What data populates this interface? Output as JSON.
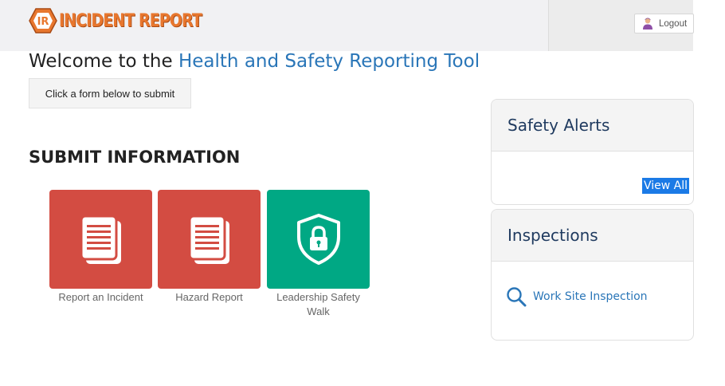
{
  "header": {
    "logo_badge": "IR",
    "logo_text": "INCIDENT REPORT",
    "logout_label": "Logout"
  },
  "welcome": {
    "prefix": "Welcome to the ",
    "accent": "Health and Safety Reporting Tool"
  },
  "hint": "Click a form below to submit",
  "section": {
    "normal": "SUBMIT ",
    "bold": "INFORMATION"
  },
  "tiles": [
    {
      "label": "Report an Incident",
      "icon": "document-icon",
      "color": "#d34c42"
    },
    {
      "label": "Hazard Report",
      "icon": "document-icon",
      "color": "#d34c42"
    },
    {
      "label": "Leadership Safety Walk",
      "icon": "shield-lock-icon",
      "color": "#00a884"
    }
  ],
  "alerts": {
    "title": "Safety Alerts",
    "view_all": "View All"
  },
  "inspections": {
    "title": "Inspections",
    "link": "Work Site Inspection"
  }
}
